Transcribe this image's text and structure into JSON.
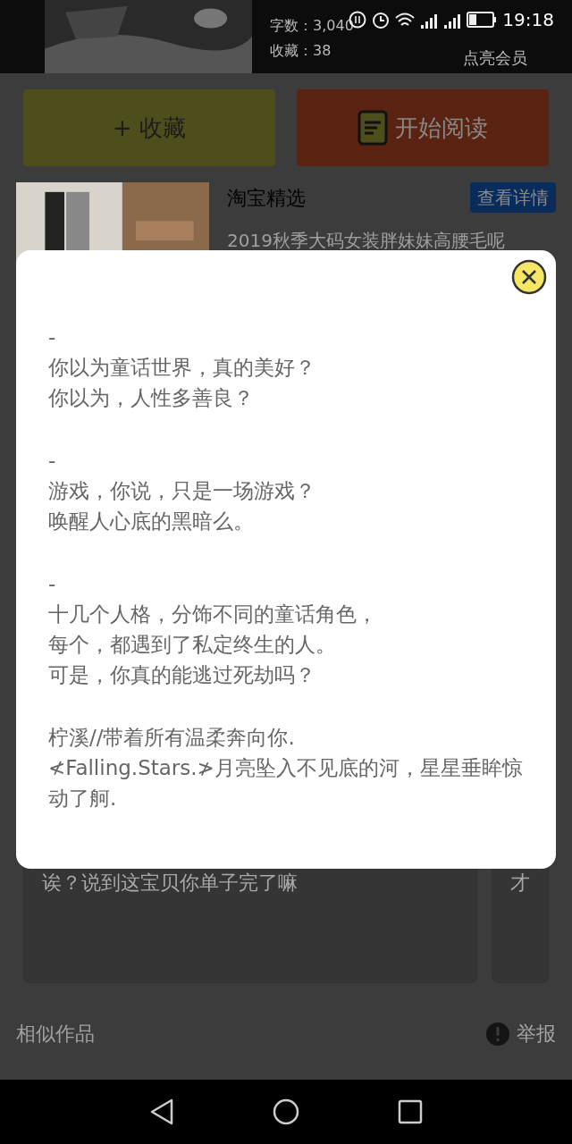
{
  "status_bar": {
    "time": "19:18"
  },
  "header": {
    "stats": [
      "字数：3,040",
      "收藏：38"
    ],
    "vip_label": "点亮会员"
  },
  "actions": [
    {
      "kind": "collect",
      "label": "+ 收藏"
    },
    {
      "kind": "read",
      "label": "开始阅读"
    }
  ],
  "ad": {
    "title": "淘宝精选",
    "button": "查看详情",
    "description": "2019秋季大码女装胖妹妹高腰毛呢"
  },
  "modal": {
    "paragraphs": [
      [
        "-",
        "你以为童话世界，真的美好？",
        "你以为，人性多善良？"
      ],
      [
        "-",
        "游戏，你说，只是一场游戏？",
        "唤醒人心底的黑暗么。"
      ],
      [
        "-",
        "十几个人格，分饰不同的童话角色，",
        "每个，都遇到了私定终生的人。",
        "可是，你真的能逃过死劫吗？"
      ],
      [
        "柠溪//带着所有温柔奔向你.",
        "≮Falling.Stars.≯月亮坠入不见底的河，星星垂眸惊动了舸."
      ]
    ]
  },
  "comments": [
    "诶？说到这宝贝你单子完了嘛",
    "才"
  ],
  "similar": {
    "title": "相似作品",
    "report": "举报"
  }
}
